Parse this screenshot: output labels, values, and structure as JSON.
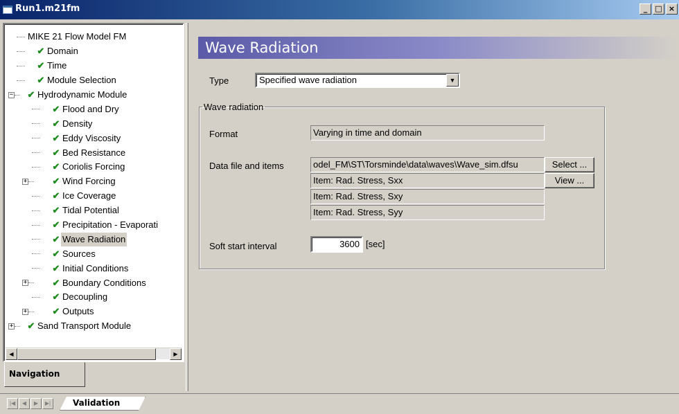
{
  "window": {
    "title": "Run1.m21fm",
    "controls": [
      "_",
      "□",
      "×"
    ]
  },
  "navigation": {
    "tab_label": "Navigation",
    "tree": [
      {
        "label": "MIKE 21 Flow Model FM",
        "level": 0,
        "check": false,
        "expander": ""
      },
      {
        "label": "Domain",
        "level": 1,
        "check": true,
        "expander": ""
      },
      {
        "label": "Time",
        "level": 1,
        "check": true,
        "expander": ""
      },
      {
        "label": "Module Selection",
        "level": 1,
        "check": true,
        "expander": ""
      },
      {
        "label": "Hydrodynamic Module",
        "level": 0,
        "check": true,
        "expander": "−"
      },
      {
        "label": "Flood and Dry",
        "level": 2,
        "check": true,
        "expander": ""
      },
      {
        "label": "Density",
        "level": 2,
        "check": true,
        "expander": ""
      },
      {
        "label": "Eddy Viscosity",
        "level": 2,
        "check": true,
        "expander": ""
      },
      {
        "label": "Bed Resistance",
        "level": 2,
        "check": true,
        "expander": ""
      },
      {
        "label": "Coriolis Forcing",
        "level": 2,
        "check": true,
        "expander": ""
      },
      {
        "label": "Wind Forcing",
        "level": 2,
        "check": true,
        "expander": "+"
      },
      {
        "label": "Ice Coverage",
        "level": 2,
        "check": true,
        "expander": ""
      },
      {
        "label": "Tidal Potential",
        "level": 2,
        "check": true,
        "expander": ""
      },
      {
        "label": "Precipitation - Evaporati",
        "level": 2,
        "check": true,
        "expander": ""
      },
      {
        "label": "Wave Radiation",
        "level": 2,
        "check": true,
        "expander": "",
        "selected": true
      },
      {
        "label": "Sources",
        "level": 2,
        "check": true,
        "expander": ""
      },
      {
        "label": "Initial Conditions",
        "level": 2,
        "check": true,
        "expander": ""
      },
      {
        "label": "Boundary Conditions",
        "level": 2,
        "check": true,
        "expander": "+"
      },
      {
        "label": "Decoupling",
        "level": 2,
        "check": true,
        "expander": ""
      },
      {
        "label": "Outputs",
        "level": 2,
        "check": true,
        "expander": "+"
      },
      {
        "label": "Sand Transport Module",
        "level": 0,
        "check": true,
        "expander": "+"
      }
    ],
    "scroll_left": "◀",
    "scroll_right": "▶"
  },
  "section": {
    "title": "Wave Radiation",
    "type_label": "Type",
    "type_value": "Specified wave radiation",
    "combo_arrow": "▼",
    "group_legend": "Wave radiation",
    "format_label": "Format",
    "format_value": "Varying in time and domain",
    "data_file_label": "Data file and items",
    "data_file_value": "odel_FM\\ST\\Torsminde\\data\\waves\\Wave_sim.dfsu",
    "items": [
      "Item:   Rad. Stress, Sxx",
      "Item:   Rad. Stress, Sxy",
      "Item:   Rad. Stress, Syy"
    ],
    "select_button": "Select ...",
    "view_button": "View ...",
    "soft_start_label": "Soft start interval",
    "soft_start_value": "3600",
    "soft_start_unit": "[sec]"
  },
  "bottom": {
    "nav_arrows": [
      "|◀",
      "◀",
      "▶",
      "▶|"
    ],
    "validation_tab": "Validation"
  }
}
